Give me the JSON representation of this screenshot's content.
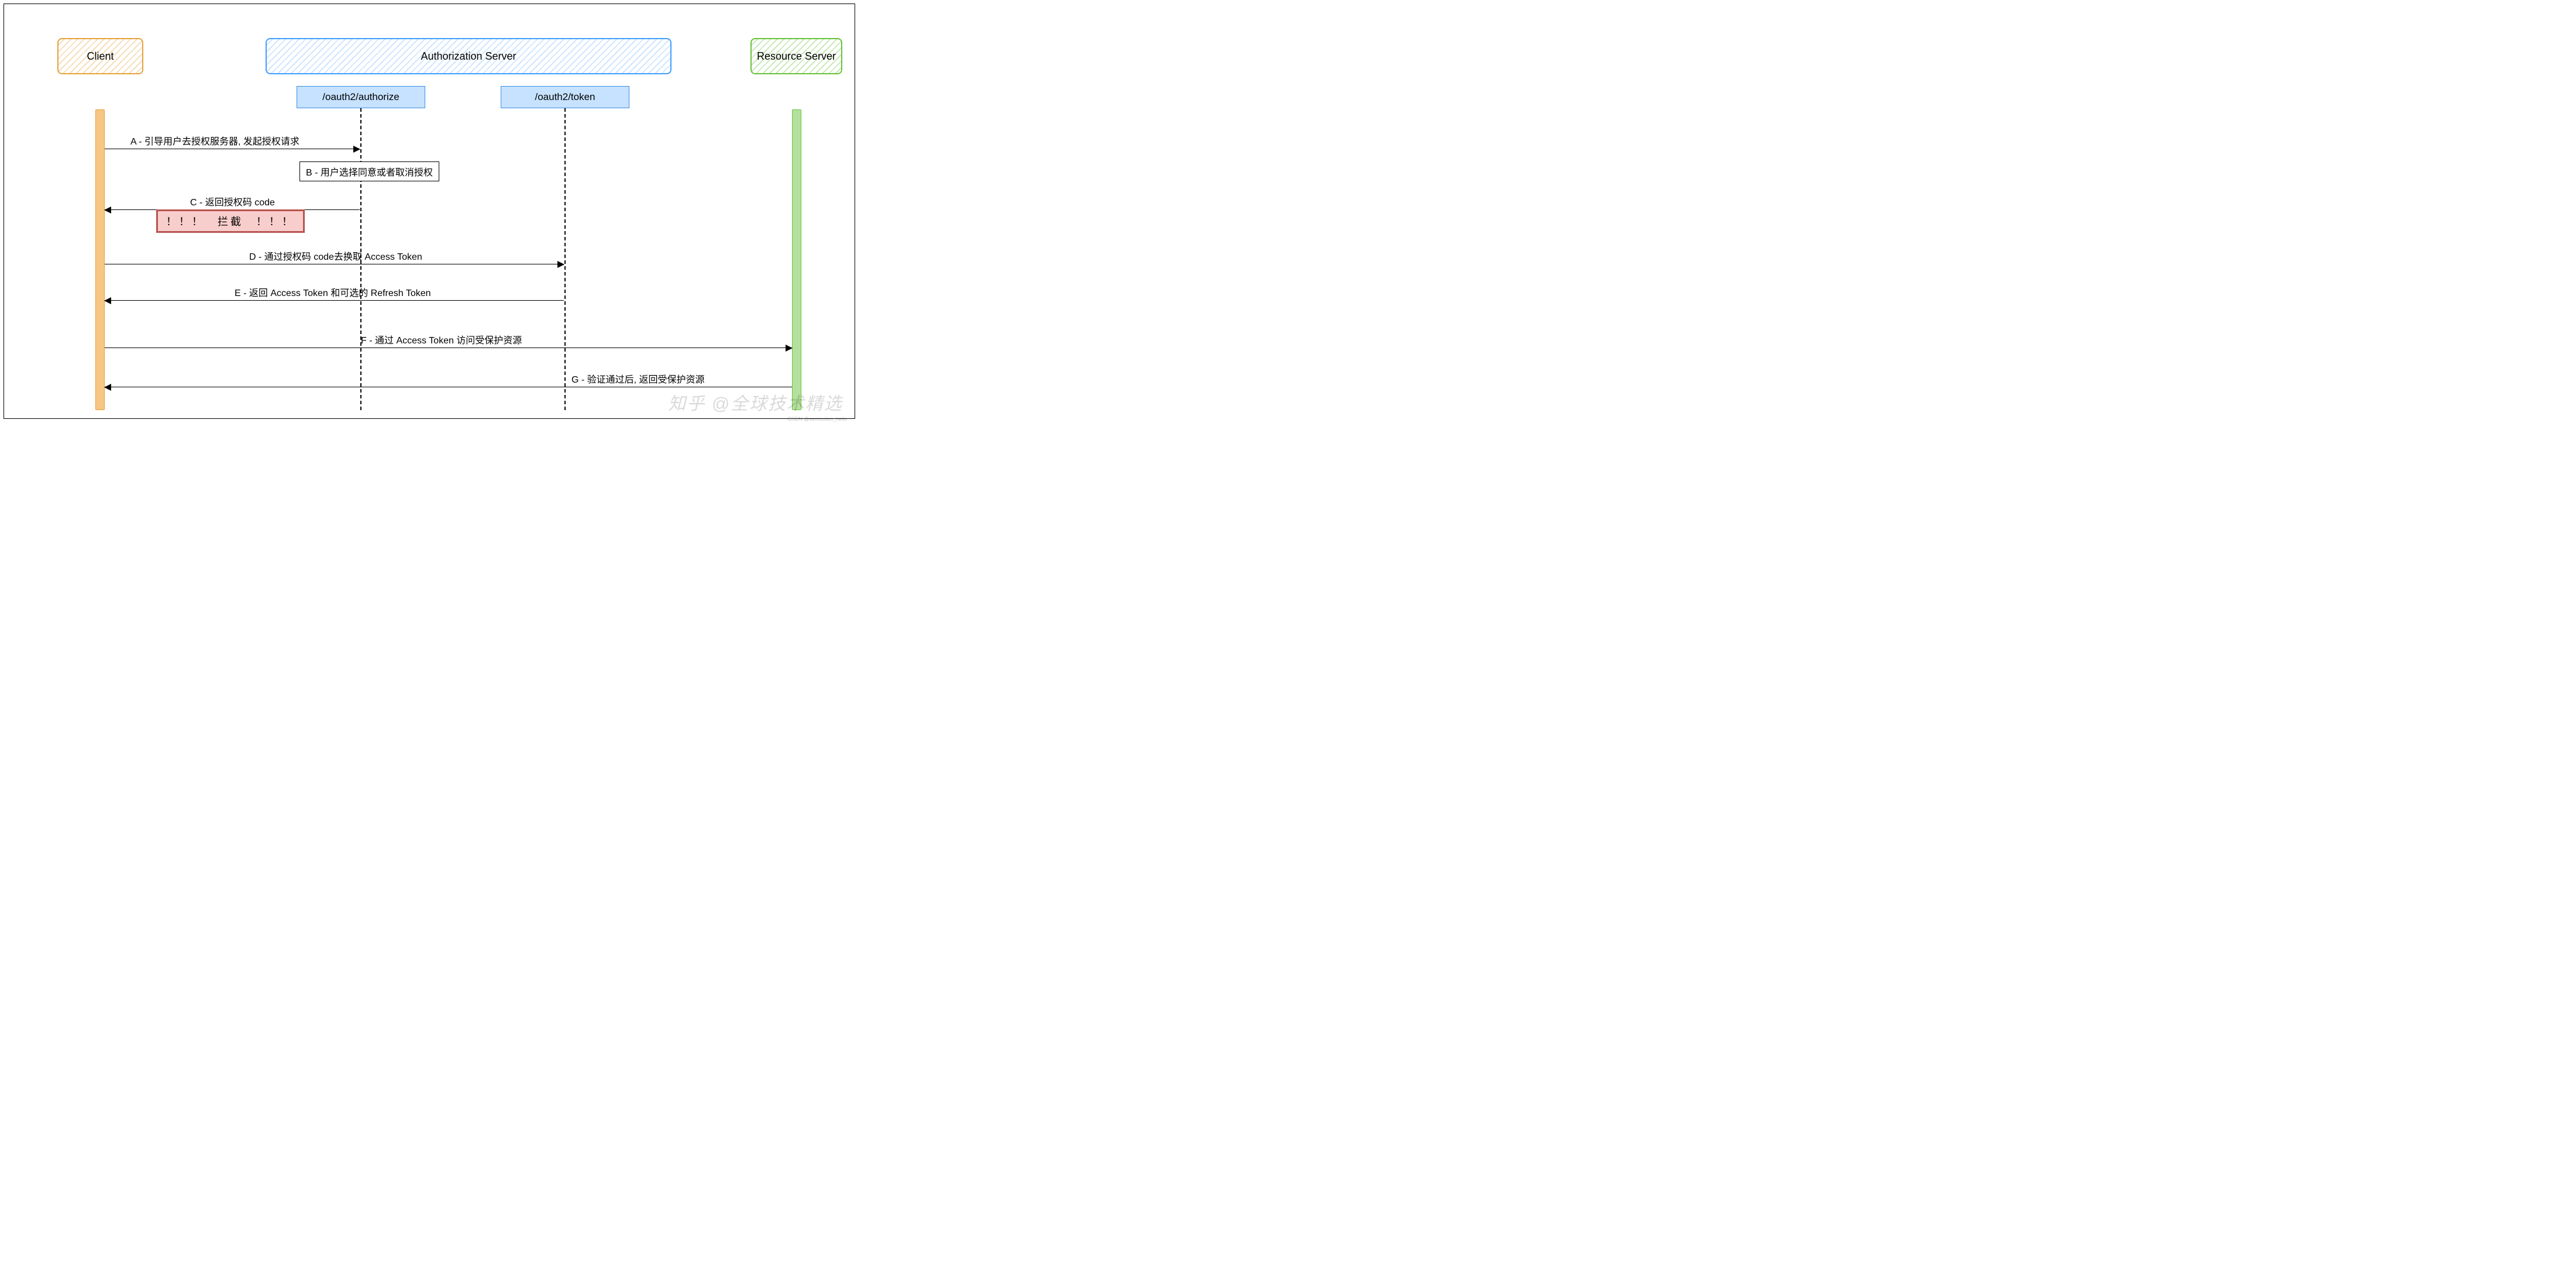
{
  "participants": {
    "client": "Client",
    "authServer": "Authorization Server",
    "resourceServer": "Resource Server"
  },
  "endpoints": {
    "authorize": "/oauth2/authorize",
    "token": "/oauth2/token"
  },
  "messages": {
    "A": "A - 引导用户去授权服务器, 发起授权请求",
    "B": "B - 用户选择同意或者取消授权",
    "C": "C - 返回授权码 code",
    "D": "D - 通过授权码 code去换取 Access Token",
    "E": "E - 返回 Access Token 和可选的 Refresh Token",
    "F": "F - 通过 Access Token 访问受保护资源",
    "G": "G - 验证通过后, 返回受保护资源"
  },
  "intercept": "！！！　拦截　！！！",
  "watermark": "知乎 @全球技术精选",
  "credit": "CSDN @semicolon_hello"
}
